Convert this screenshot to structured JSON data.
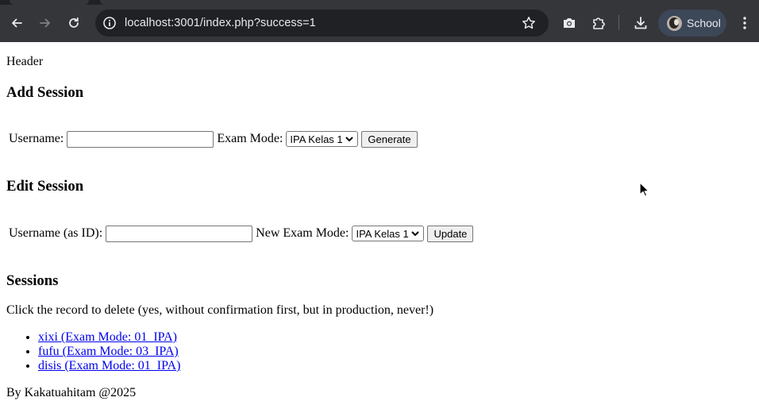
{
  "browser": {
    "url": "localhost:3001/index.php?success=1",
    "profile_name": "School",
    "icons": {
      "back": "arrow-left-icon",
      "forward": "arrow-right-icon",
      "reload": "reload-icon",
      "site_info": "info-icon",
      "bookmark": "star-icon",
      "screenshot": "camera-icon",
      "extensions": "puzzle-icon",
      "downloads": "download-icon",
      "menu": "kebab-menu-icon"
    },
    "colors": {
      "toolbar_bg": "#35363a",
      "omnibox_bg": "#202124",
      "profile_chip_bg": "#3c4758",
      "text": "#e8eaed"
    }
  },
  "page": {
    "header_text": "Header",
    "add_session": {
      "heading": "Add Session",
      "username_label": "Username:",
      "username_value": "",
      "exam_mode_label": "Exam Mode:",
      "exam_mode_selected": "IPA Kelas 1",
      "submit_label": "Generate"
    },
    "edit_session": {
      "heading": "Edit Session",
      "username_label": "Username (as ID):",
      "username_value": "",
      "exam_mode_label": "New Exam Mode:",
      "exam_mode_selected": "IPA Kelas 1",
      "submit_label": "Update"
    },
    "sessions": {
      "heading": "Sessions",
      "note": "Click the record to delete (yes, without confirmation first, but in production, never!)",
      "items": [
        {
          "label": "xixi (Exam Mode: 01_IPA)"
        },
        {
          "label": "fufu (Exam Mode: 03_IPA)"
        },
        {
          "label": "disis (Exam Mode: 01_IPA)"
        }
      ],
      "link_color": "#0000ee"
    },
    "footer_text": "By Kakatuahitam @2025"
  }
}
